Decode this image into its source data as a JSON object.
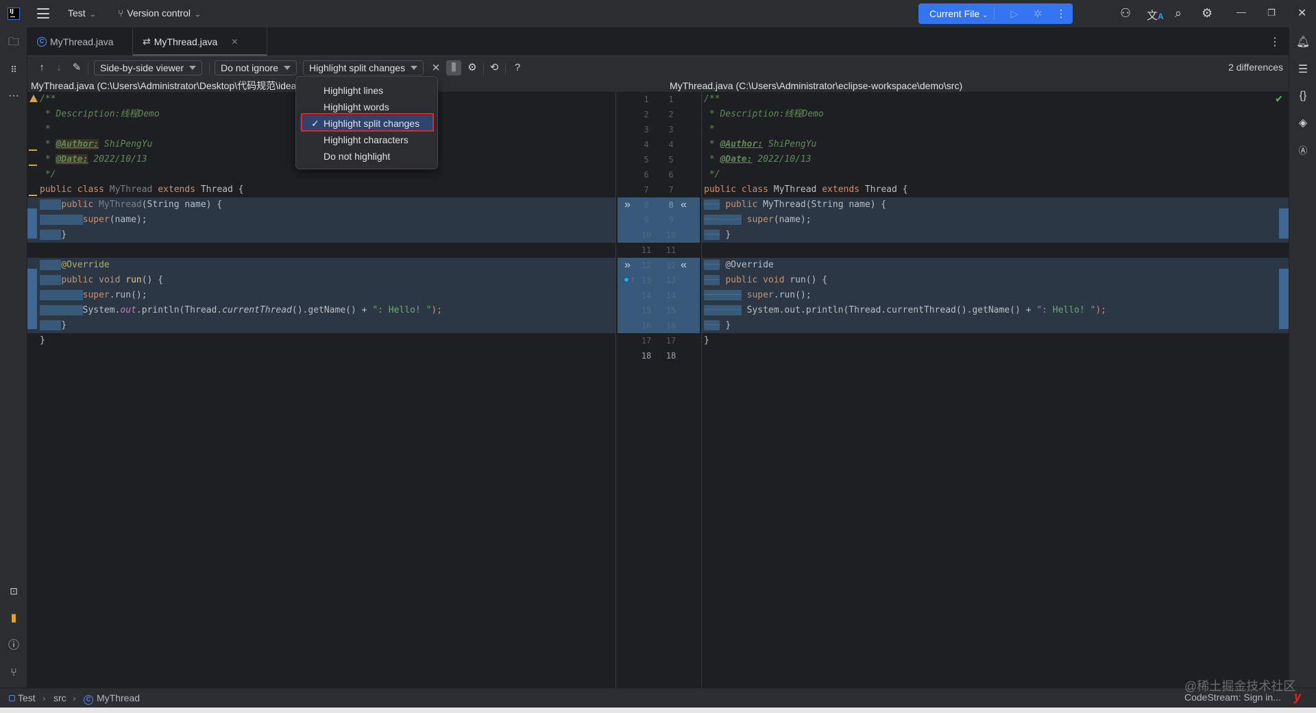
{
  "titlebar": {
    "project": "Test",
    "version_control": "Version control",
    "run_config": "Current File",
    "icons": [
      "app-logo-icon",
      "main-menu-icon",
      "run-icon",
      "debug-icon",
      "more-icon",
      "add-user-icon",
      "translate-icon",
      "search-icon",
      "settings-icon",
      "minimize-icon",
      "restore-icon",
      "close-icon"
    ]
  },
  "tabs": [
    {
      "label": "MyThread.java",
      "icon": "java-class-icon",
      "active": false
    },
    {
      "label": "MyThread.java",
      "icon": "diff-icon",
      "active": true,
      "closable": true
    }
  ],
  "toolbar": {
    "viewer": "Side-by-side viewer",
    "ignore": "Do not ignore",
    "highlight": "Highlight split changes",
    "differences": "2 differences",
    "help": "?"
  },
  "paths": {
    "left": "MyThread.java (C:\\Users\\Administrator\\Desktop\\代码规范\\idea",
    "right": "MyThread.java (C:\\Users\\Administrator\\eclipse-workspace\\demo\\src)"
  },
  "highlight_menu": {
    "items": [
      "Highlight lines",
      "Highlight words",
      "Highlight split changes",
      "Highlight characters",
      "Do not highlight"
    ],
    "selected": "Highlight split changes"
  },
  "code": {
    "comment_open": "/**",
    "desc_star": " * ",
    "desc": "Description:线程Demo",
    "star": " *",
    "author_tag": "@Author:",
    "author": " ShiPengYu",
    "date_tag": "@Date:",
    "date": " 2022/10/13",
    "comment_close": " */",
    "kw_public": "public",
    "kw_class": "class",
    "class_name": "MyThread",
    "kw_extends": "extends",
    "super_class": "Thread",
    "open_brace": " {",
    "ctor_args": "(String name) {",
    "kw_super": "super",
    "super_call": "(name);",
    "close_brace": "}",
    "override": "@Override",
    "kw_void": "void",
    "run_sig": "run",
    "run_args": "() {",
    "super_run": ".run();",
    "println_1": "System.",
    "println_out": "out",
    "println_2": ".println(Thread.",
    "println_ct": "currentThread",
    "println_3": "().getName() + ",
    "println_str": "\": Hello! \"",
    "println_4": ");",
    "println_plain": "System.out.println(Thread.currentThread().getName() + "
  },
  "line_numbers": [
    "1",
    "2",
    "3",
    "4",
    "5",
    "6",
    "7",
    "8",
    "9",
    "10",
    "11",
    "12",
    "13",
    "14",
    "15",
    "16",
    "17",
    "18"
  ],
  "gutter": {
    "apply_left": "»",
    "apply_right": "«"
  },
  "breadcrumb": [
    "Test",
    "src",
    "MyThread"
  ],
  "statusbar": {
    "codestream": "CodeStream:  Sign in...",
    "watermark": "@稀土掘金技术社区"
  },
  "colors": {
    "accent": "#3574f0",
    "change_bg": "#2b3744",
    "change_ws": "#375a7b",
    "selection_box": "#e0262a"
  }
}
